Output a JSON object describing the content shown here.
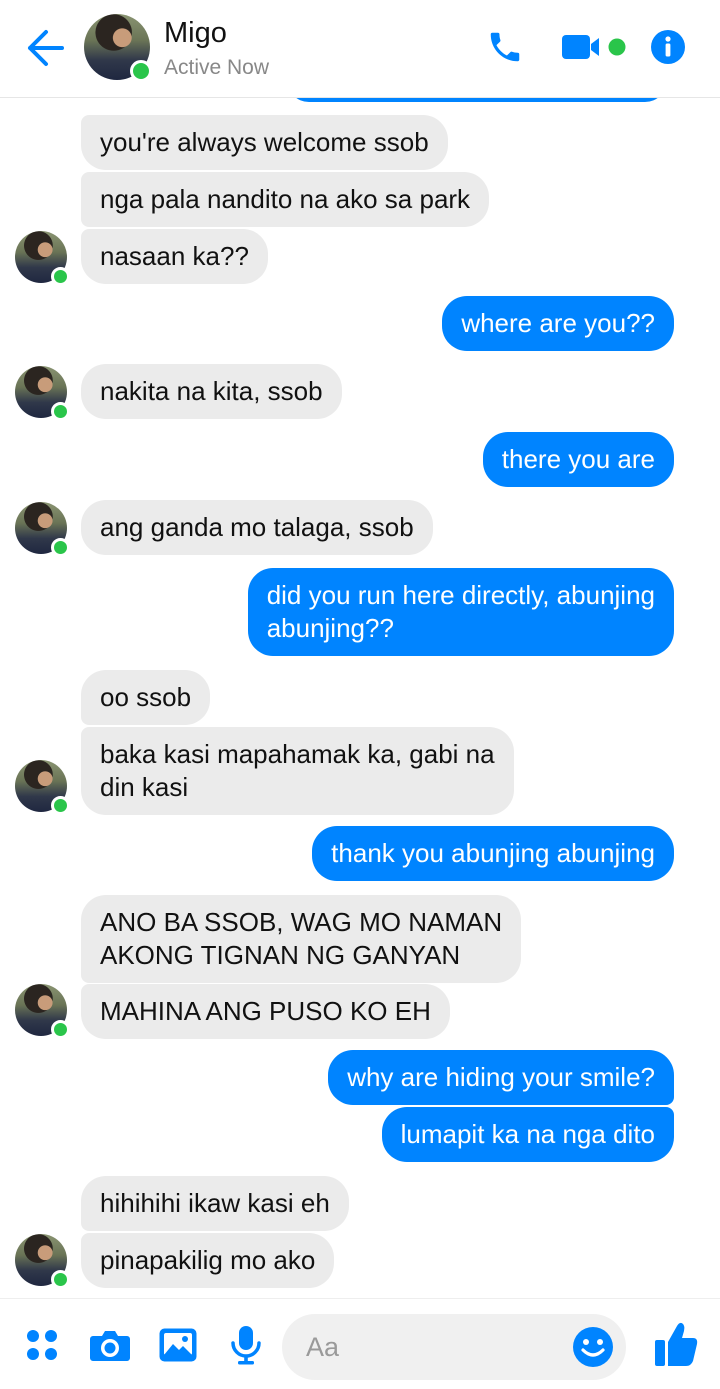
{
  "header": {
    "name": "Migo",
    "status": "Active Now"
  },
  "messages": [
    {
      "side": "in",
      "text": "you're always welcome ssob"
    },
    {
      "side": "in",
      "text": "nga pala nandito na ako sa park"
    },
    {
      "side": "in",
      "text": "nasaan ka??",
      "avatar": true
    },
    {
      "side": "out",
      "text": "where are you??"
    },
    {
      "side": "in",
      "text": "nakita na kita, ssob",
      "avatar": true
    },
    {
      "side": "out",
      "text": "there you are"
    },
    {
      "side": "in",
      "text": "ang ganda mo talaga, ssob",
      "avatar": true
    },
    {
      "side": "out",
      "text": "did you run here directly, abunjing",
      "text2": "abunjing??"
    },
    {
      "side": "in",
      "text": "oo ssob"
    },
    {
      "side": "in",
      "text": "baka kasi mapahamak ka, gabi na",
      "text2": "din kasi",
      "avatar": true
    },
    {
      "side": "out",
      "text": "thank you abunjing abunjing"
    },
    {
      "side": "in",
      "text": "ANO BA SSOB, WAG MO NAMAN",
      "text2": "AKONG TIGNAN NG GANYAN"
    },
    {
      "side": "in",
      "text": "MAHINA ANG PUSO KO EH",
      "avatar": true
    },
    {
      "side": "out",
      "text": "why are hiding your smile?"
    },
    {
      "side": "out",
      "text": "lumapit ka na nga dito"
    },
    {
      "side": "in",
      "text": "hihihihi ikaw kasi eh"
    },
    {
      "side": "in",
      "text": "pinapakilig mo ako",
      "avatar": true
    }
  ],
  "composer": {
    "placeholder": "Aa"
  },
  "icons": {
    "back": "back-arrow-icon",
    "call": "phone-icon",
    "video": "video-camera-icon",
    "info": "info-icon",
    "more": "four-dots-icon",
    "camera": "camera-icon",
    "gallery": "image-icon",
    "mic": "microphone-icon",
    "emoji": "smiley-icon",
    "like": "thumbs-up-icon"
  },
  "colors": {
    "accent": "#0084ff",
    "incoming": "#ebebeb",
    "online": "#2ac54a"
  }
}
